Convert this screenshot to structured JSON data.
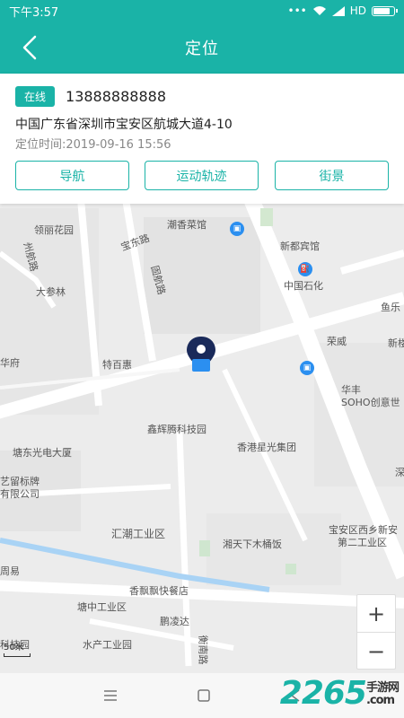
{
  "status": {
    "time": "下午3:57",
    "signal": "HD"
  },
  "header": {
    "title": "定位"
  },
  "card": {
    "badge": "在线",
    "phone": "13888888888",
    "address": "中国广东省深圳市宝安区航城大道4-10",
    "time_label": "定位时间:2019-09-16 15:56",
    "buttons": {
      "navigate": "导航",
      "track": "运动轨迹",
      "street": "街景"
    }
  },
  "map": {
    "labels": {
      "a": "领丽花园",
      "b": "宝东路",
      "c": "潮香菜馆",
      "d": "州航路",
      "e": "新都宾馆",
      "f": "大参林",
      "g": "固航路",
      "h": "中国石化",
      "i": "鱼乐",
      "j": "荣威",
      "k": "新楼",
      "l": "华府",
      "m": "特百惠",
      "n": "华丰",
      "o": "SOHO创意世",
      "p": "鑫辉腾科技园",
      "q": "香港星光集团",
      "r": "塘东光电大厦",
      "s": "深",
      "t": "艺留标牌",
      "u": "有限公司",
      "v": "汇潮工业区",
      "w": "宝安区西乡新安",
      "x": "第二工业区",
      "y": "湘天下木桶饭",
      "z": "周易",
      "aa": "香飘飘快餐店",
      "ab": "塘中工业区",
      "ac": "鹏凌达",
      "ad": "水产工业园",
      "ae": "衡南路",
      "af": "科技园",
      "ag": "石化"
    },
    "scale": "50米",
    "zoom_in": "+",
    "zoom_out": "−"
  },
  "watermark": {
    "brand": "2265",
    "sub1": "手游网",
    "sub2": ".com"
  },
  "colors": {
    "accent": "#1ab3a7",
    "marker": "#1a2a5a",
    "poi": "#2b8ff0"
  }
}
